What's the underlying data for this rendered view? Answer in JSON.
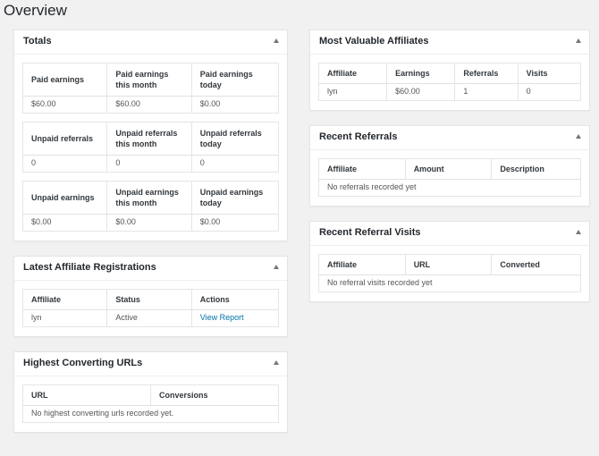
{
  "page": {
    "title": "Overview"
  },
  "totals": {
    "title": "Totals",
    "earnings": {
      "headers": [
        "Paid earnings",
        "Paid earnings this month",
        "Paid earnings today"
      ],
      "values": [
        "$60.00",
        "$60.00",
        "$0.00"
      ]
    },
    "unpaid_referrals": {
      "headers": [
        "Unpaid referrals",
        "Unpaid referrals this month",
        "Unpaid referrals today"
      ],
      "values": [
        "0",
        "0",
        "0"
      ]
    },
    "unpaid_earnings": {
      "headers": [
        "Unpaid earnings",
        "Unpaid earnings this month",
        "Unpaid earnings today"
      ],
      "values": [
        "$0.00",
        "$0.00",
        "$0.00"
      ]
    }
  },
  "registrations": {
    "title": "Latest Affiliate Registrations",
    "headers": [
      "Affiliate",
      "Status",
      "Actions"
    ],
    "rows": [
      {
        "affiliate": "lyn",
        "status": "Active",
        "action": "View Report"
      }
    ]
  },
  "converting": {
    "title": "Highest Converting URLs",
    "headers": [
      "URL",
      "Conversions"
    ],
    "empty": "No highest converting urls recorded yet."
  },
  "valuable": {
    "title": "Most Valuable Affiliates",
    "headers": [
      "Affiliate",
      "Earnings",
      "Referrals",
      "Visits"
    ],
    "rows": [
      {
        "affiliate": "lyn",
        "earnings": "$60.00",
        "referrals": "1",
        "visits": "0"
      }
    ]
  },
  "referrals": {
    "title": "Recent Referrals",
    "headers": [
      "Affiliate",
      "Amount",
      "Description"
    ],
    "empty": "No referrals recorded yet"
  },
  "visits": {
    "title": "Recent Referral Visits",
    "headers": [
      "Affiliate",
      "URL",
      "Converted"
    ],
    "empty": "No referral visits recorded yet"
  }
}
